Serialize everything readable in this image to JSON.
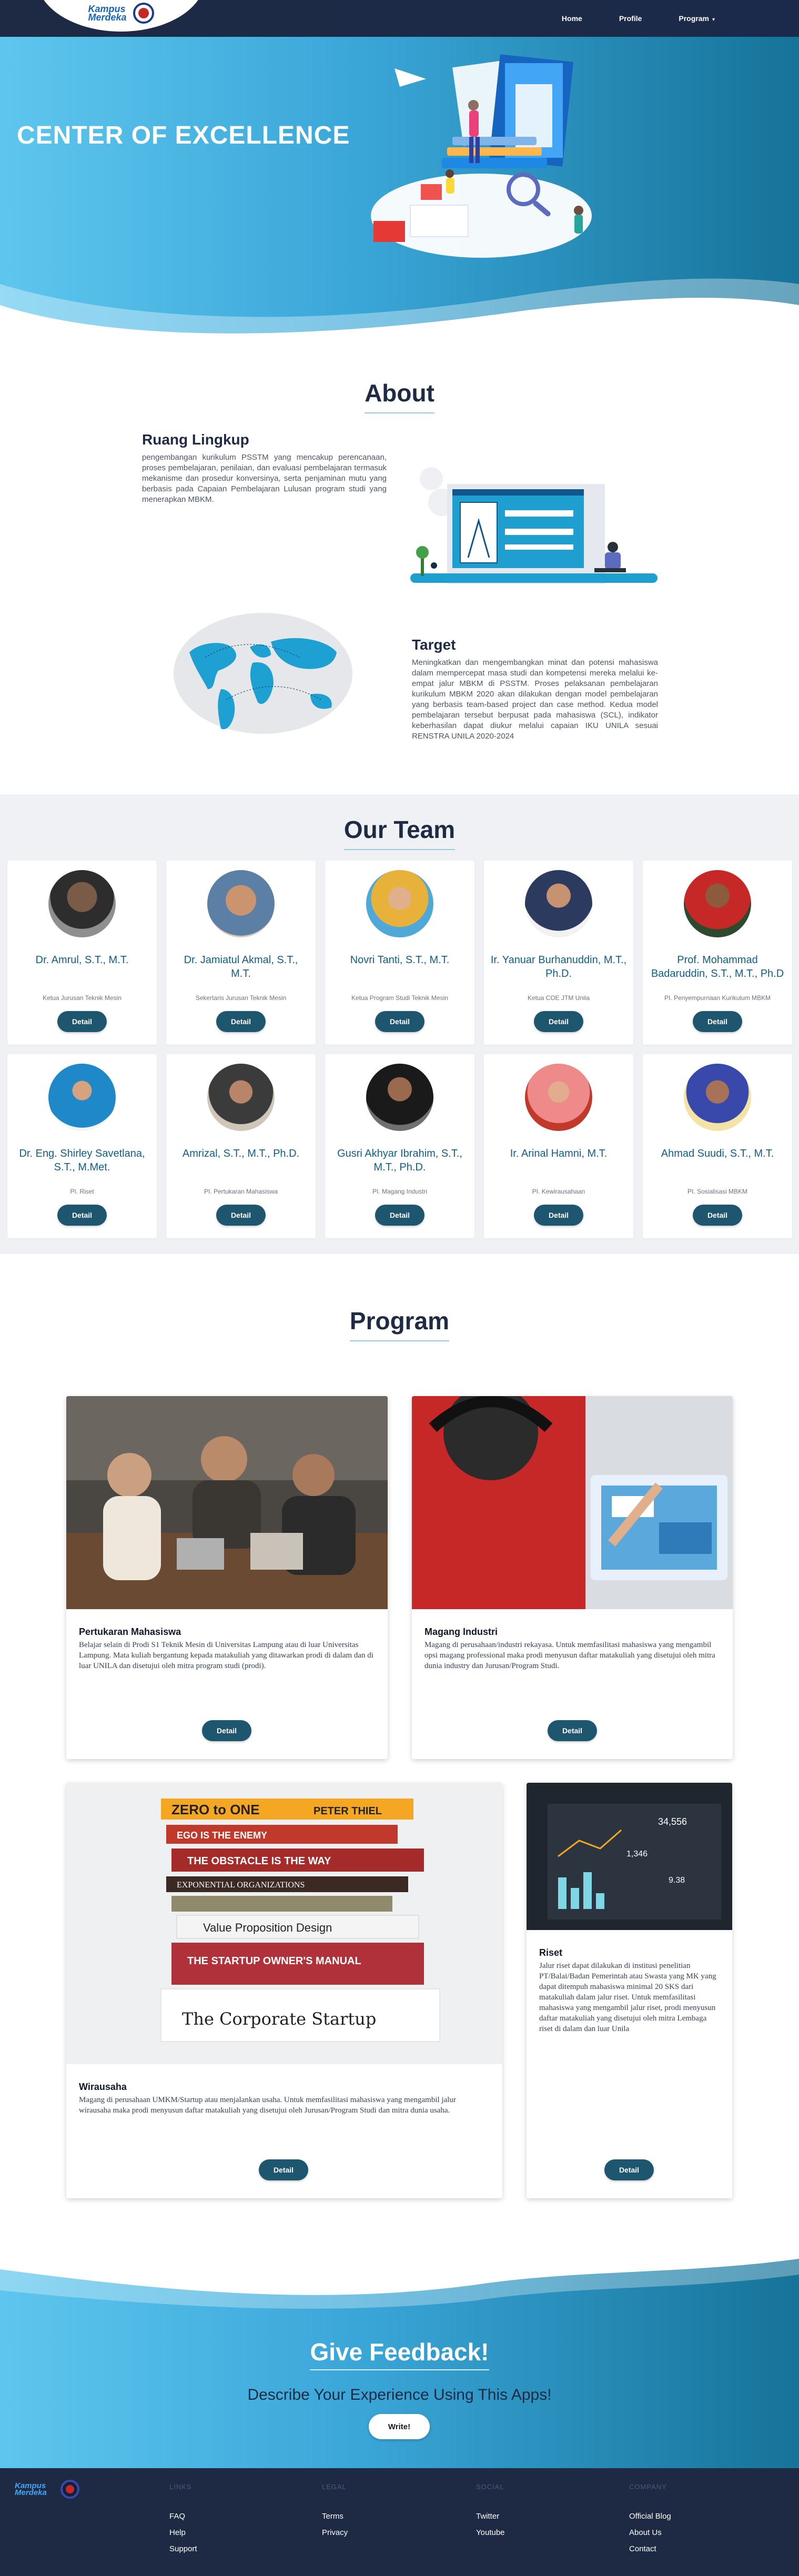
{
  "navbar": {
    "logo_text_1": "Kampus",
    "logo_text_2": "Merdeka",
    "links": [
      {
        "label": "Home"
      },
      {
        "label": "Profile"
      },
      {
        "label": "Program"
      }
    ]
  },
  "hero": {
    "title": "CENTER OF EXCELLENCE"
  },
  "about": {
    "title": "About",
    "ruang": {
      "heading": "Ruang Lingkup",
      "text": "pengembangan kurikulum PSSTM yang mencakup perencanaan, proses pembelajaran, penilaian, dan evaluasi pembelajaran termasuk mekanisme dan prosedur konversinya, serta penjaminan mutu yang berbasis pada Capaian Pembelajaran Lulusan program studi yang menerapkan MBKM."
    },
    "target": {
      "heading": "Target",
      "text": "Meningkatkan dan mengembangkan minat dan potensi mahasiswa dalam mempercepat masa studi dan kompetensi mereka melalui ke-empat jalur MBKM di PSSTM. Proses pelaksanan pembelajaran kurikulum MBKM 2020 akan dilakukan dengan model pembelajaran yang berbasis team-based project dan case method. Kedua model pembelajaran tersebut berpusat pada mahasiswa (SCL), indikator keberhasilan dapat diukur melalui capaian IKU UNILA sesuai RENSTRA UNILA 2020-2024"
    }
  },
  "team": {
    "title": "Our Team",
    "detail_label": "Detail",
    "members": [
      {
        "name": "Dr. Amrul, S.T., M.T.",
        "role": "Ketua Jurusan Teknik Mesin"
      },
      {
        "name": "Dr. Jamiatul Akmal, S.T., M.T.",
        "role": "Sekertaris Jurusan Teknik Mesin"
      },
      {
        "name": "Novri Tanti, S.T., M.T.",
        "role": "Ketua Program Studi Teknik Mesin"
      },
      {
        "name": "Ir. Yanuar Burhanuddin, M.T., Ph.D.",
        "role": "Ketua COE JTM Unila"
      },
      {
        "name": "Prof. Mohammad Badaruddin, S.T., M.T., Ph.D",
        "role": "PI. Penyempurnaan Kurikulum MBKM"
      },
      {
        "name": "Dr. Eng. Shirley Savetlana, S.T., M.Met.",
        "role": "PI. Riset"
      },
      {
        "name": "Amrizal, S.T., M.T., Ph.D.",
        "role": "PI. Pertukaran Mahasiswa"
      },
      {
        "name": "Gusri Akhyar Ibrahim, S.T., M.T., Ph.D.",
        "role": "PI. Magang Industri"
      },
      {
        "name": "Ir. Arinal Hamni, M.T.",
        "role": "PI. Kewirausahaan"
      },
      {
        "name": "Ahmad Suudi, S.T., M.T.",
        "role": "PI. Sosialisasi MBKM"
      }
    ]
  },
  "program": {
    "title": "Program",
    "detail_label": "Detail",
    "cards": [
      {
        "title": "Pertukaran Mahasiswa",
        "text": "Belajar selain di Prodi S1 Teknik Mesin di Universitas Lampung atau di luar Universitas Lampung. Mata kuliah bergantung kepada matakuliah yang ditawarkan prodi di dalam dan di luar UNILA dan disetujui oleh mitra program studi (prodi)."
      },
      {
        "title": "Magang Industri",
        "text": "Magang di perusahaan/industri rekayasa. Untuk memfasilitasi mahasiswa yang mengambil opsi magang professional maka prodi menyusun daftar matakuliah yang disetujui oleh mitra dunia industry dan Jurusan/Program Studi."
      },
      {
        "title": "Wirausaha",
        "text": "Magang di perusahaan UMKM/Startup atau menjalankan usaha. Untuk memfasilitasi mahasiswa yang mengambil jalur wirausaha maka prodi menyusun daftar matakuliah yang disetujui oleh Jurusan/Program Studi dan mitra dunia usaha."
      },
      {
        "title": "Riset",
        "text": "Jalur riset dapat dilakukan di institusi penelitian PT/Balai/Badan Pemerintah atau Swasta yang MK yang dapat ditempuh mahasiswa minimal 20 SKS dari matakuliah dalam jalur riset. Untuk memfasilitasi mahasiswa yang mengambil jalur riset, prodi menyusun daftar matakuliah yang disetujui oleh mitra Lembaga riset di dalam dan luar Unila"
      }
    ],
    "book_titles": [
      "ZERO to ONE",
      "PETER THIEL",
      "EGO IS THE ENEMY",
      "THE OBSTACLE IS THE WAY",
      "EXPONENTIAL ORGANIZATIONS",
      "Value Proposition Design",
      "THE STARTUP OWNER'S MANUAL",
      "The Corporate Startup"
    ],
    "screen_text": [
      "34,556",
      "1,346",
      "9.38"
    ]
  },
  "feedback": {
    "title": "Give Feedback!",
    "subtitle": "Describe Your Experience Using This Apps!",
    "button": "Write!"
  },
  "footer": {
    "logo_text_1": "Kampus",
    "logo_text_2": "Merdeka",
    "columns": [
      {
        "heading": "LINKS",
        "links": [
          "FAQ",
          "Help",
          "Support"
        ]
      },
      {
        "heading": "LEGAL",
        "links": [
          "Terms",
          "Privacy"
        ]
      },
      {
        "heading": "SOCIAL",
        "links": [
          "Twitter",
          "Youtube"
        ]
      },
      {
        "heading": "COMPANY",
        "links": [
          "Official Blog",
          "About Us",
          "Contact"
        ]
      }
    ]
  }
}
